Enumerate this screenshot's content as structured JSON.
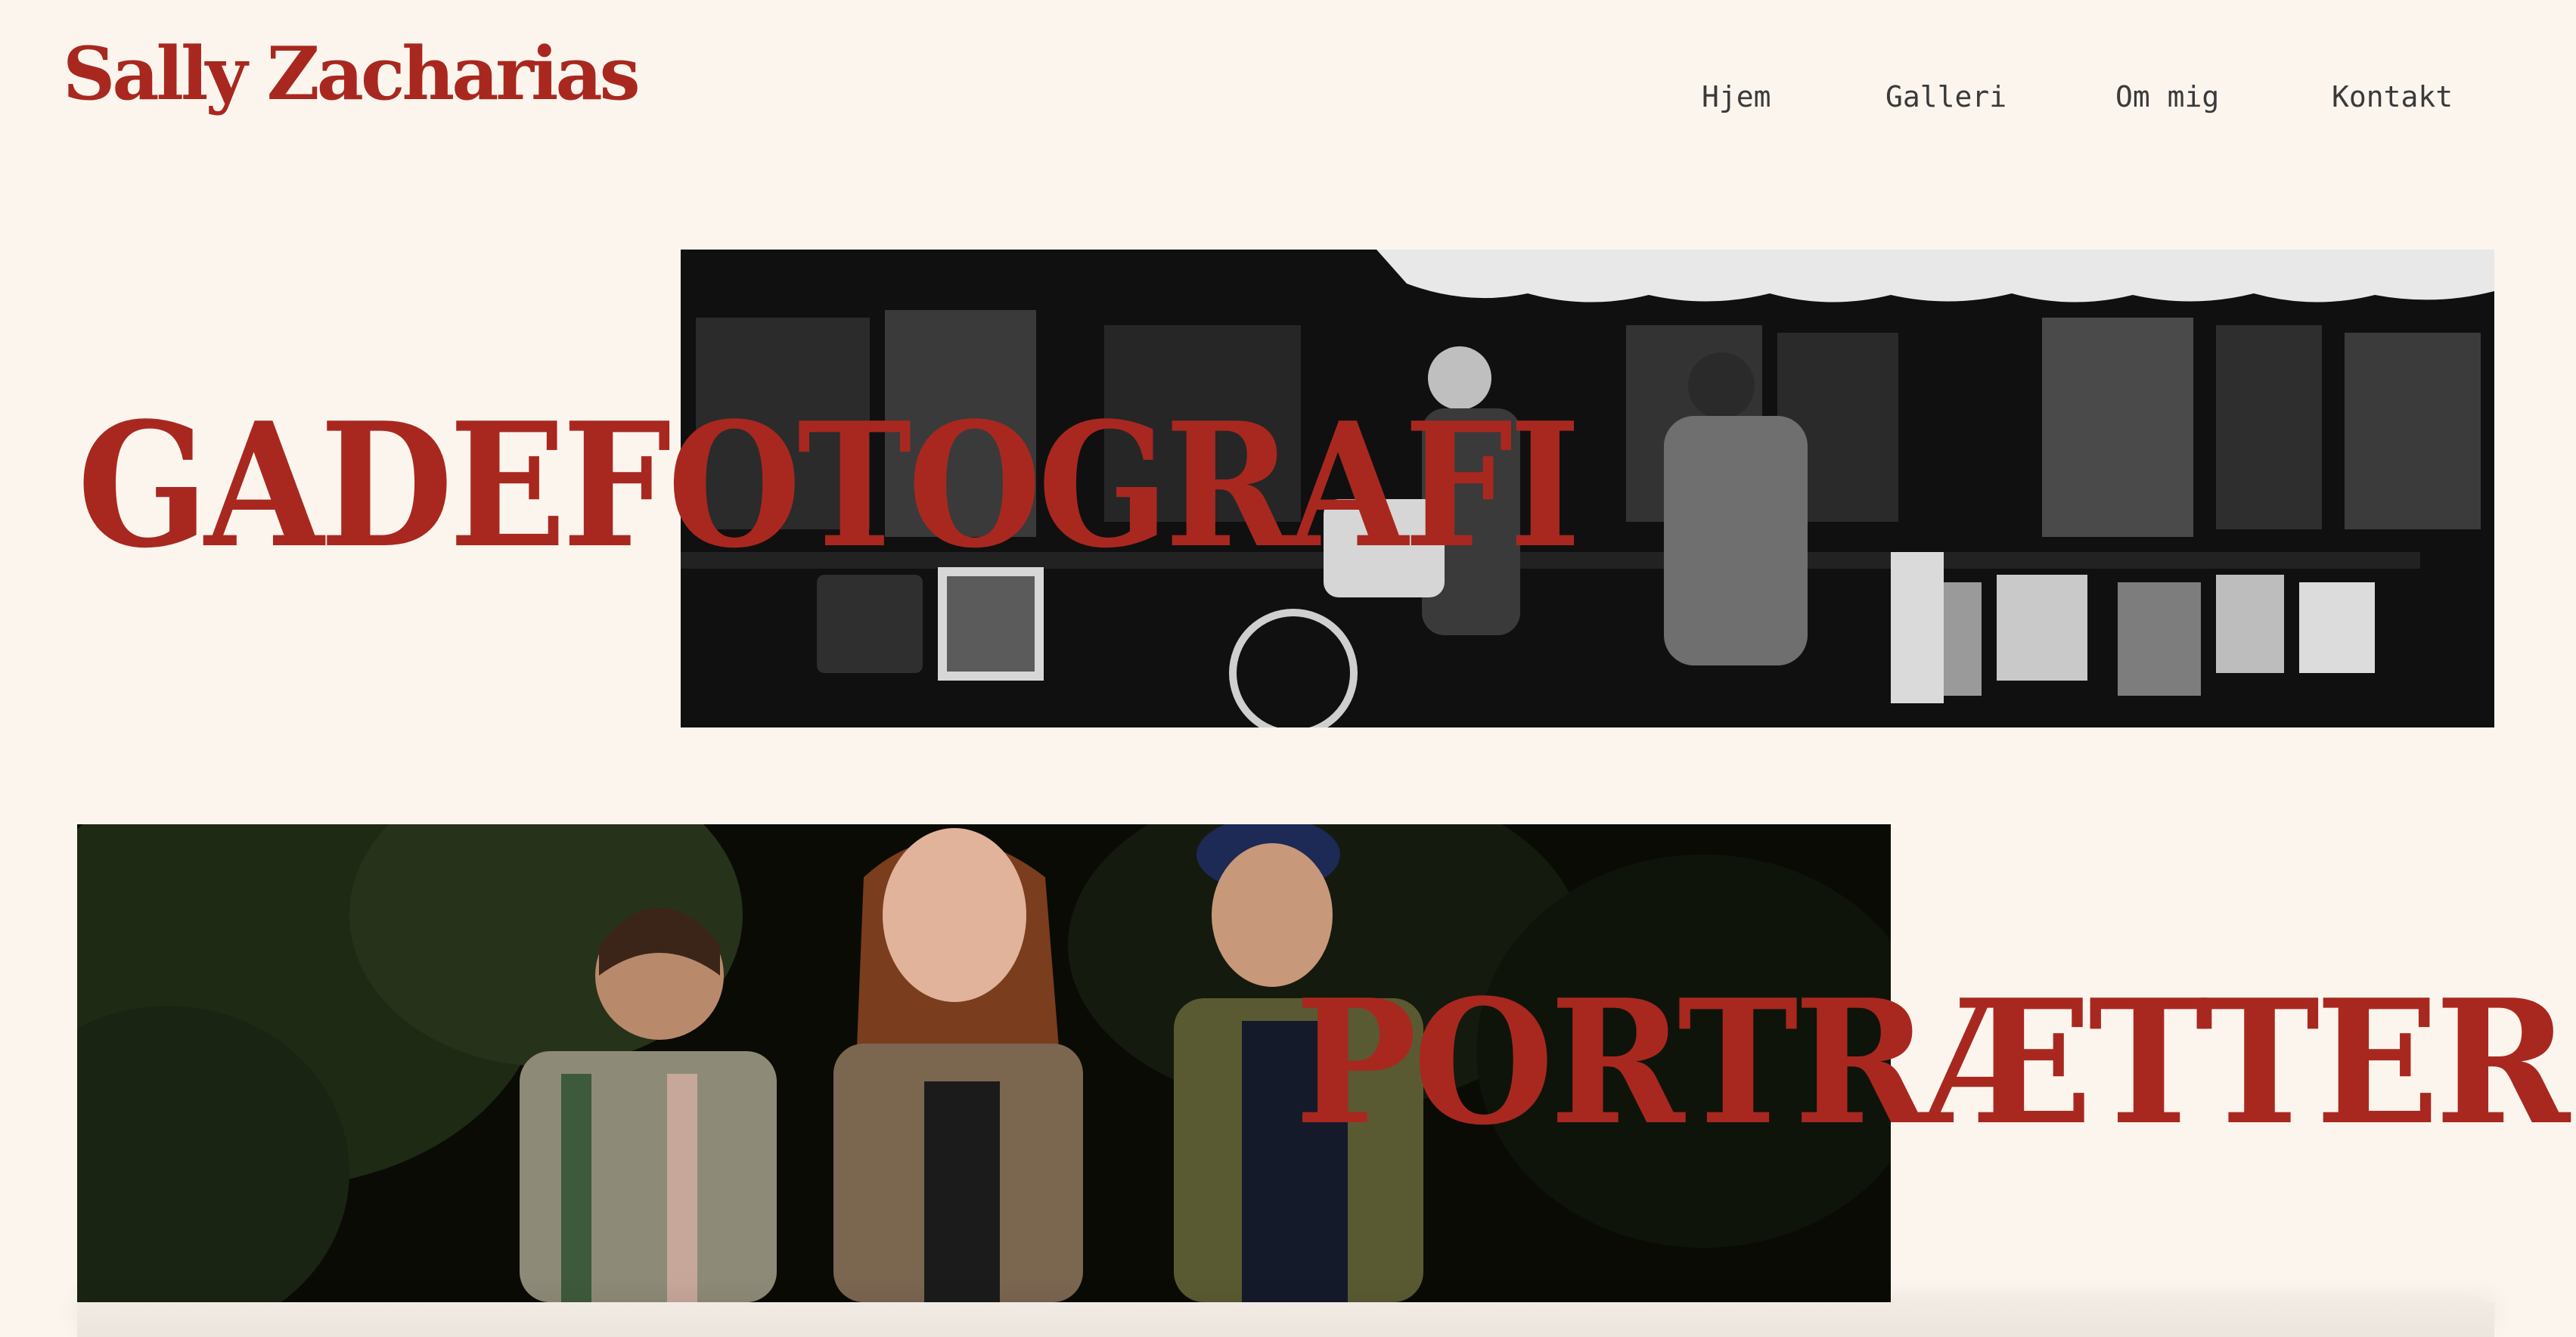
{
  "header": {
    "logo_text": "Sally Zacharias"
  },
  "nav": {
    "items": [
      {
        "label": "Hjem"
      },
      {
        "label": "Galleri"
      },
      {
        "label": "Om mig"
      },
      {
        "label": "Kontakt"
      }
    ]
  },
  "sections": [
    {
      "title": "GADEFOTOGRAFI",
      "image": "black-and-white street market photo"
    },
    {
      "title": "PORTRÆTTER",
      "image": "color group portrait photo"
    }
  ],
  "colors": {
    "background": "#fcf5ee",
    "accent": "#a8281f",
    "nav_text": "#3a3a3a"
  }
}
